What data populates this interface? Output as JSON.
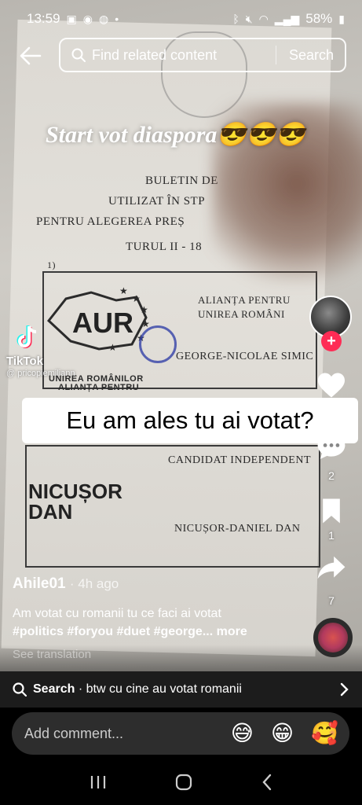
{
  "status_bar": {
    "time": "13:59",
    "battery": "58%"
  },
  "search": {
    "placeholder": "Find related content",
    "button": "Search"
  },
  "video": {
    "overlay_title": "Start vot diaspora😎😎😎",
    "caption": "Eu am ales tu ai votat?",
    "ballot": {
      "line1": "BULETIN DE",
      "line2": "UTILIZAT ÎN STP",
      "line3": "PENTRU ALEGEREA PREȘ",
      "line4": "TURUL II - 18",
      "num": "1)",
      "party_logo": "AUR",
      "party_small": "ALIANȚA PENTRU",
      "party_small2": "UNIREA ROMÂNILOR",
      "party_right": "ALIANȚA PENTRU",
      "party_right2": "UNIREA ROMÂNI",
      "candidate1": "GEORGE-NICOLAE SIMIC",
      "independent": "CANDIDAT INDEPENDENT",
      "logo2_line1": "NICUȘOR",
      "logo2_line2": "DAN",
      "candidate2": "NICUȘOR-DANIEL DAN"
    }
  },
  "watermark": {
    "brand": "TikTok",
    "handle": "@ pricopiemiliann"
  },
  "rail": {
    "comments_count": "2",
    "saves_count": "1",
    "shares_count": "7"
  },
  "post": {
    "author": "Ahile01",
    "time": "· 4h ago",
    "text": "Am votat cu romanii tu ce faci ai votat",
    "tags": "#politics #foryou #duet #george...",
    "more": "more",
    "see_translation": "See translation"
  },
  "suggestion": {
    "label": "Search",
    "query": "· btw cu cine au votat romanii"
  },
  "comment_bar": {
    "placeholder": "Add comment...",
    "emojis": [
      "😅",
      "😁",
      "🥰"
    ]
  }
}
